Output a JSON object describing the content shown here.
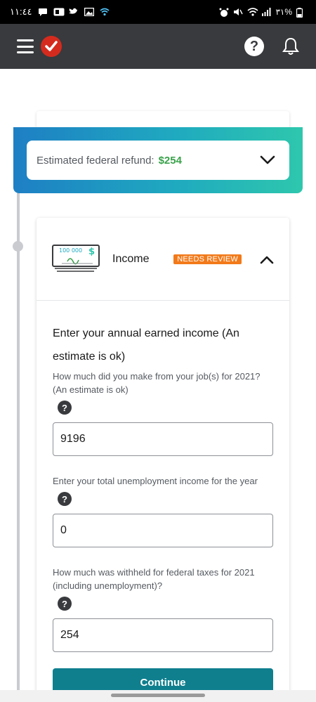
{
  "status_bar": {
    "time": "١١:٤٤",
    "battery": "٣١%"
  },
  "header": {
    "menu_icon": "hamburger-icon",
    "logo_icon": "checkmark-logo-icon",
    "help_label": "?",
    "bell_icon": "bell-icon"
  },
  "refund": {
    "label": "Estimated federal refund:",
    "amount": "$254",
    "amount_color": "#3aa24b"
  },
  "income": {
    "title": "Income",
    "badge": "NEEDS REVIEW",
    "badge_color": "#f27a1a",
    "check_text": "100 000",
    "section_title_line1": "Enter your annual earned income (An",
    "section_title_line2": "estimate is ok)",
    "questions": [
      {
        "label": "How much did you make from your job(s) for 2021? (An estimate is ok)",
        "value": "9196"
      },
      {
        "label": "Enter your total unemployment income for the year",
        "value": "0"
      },
      {
        "label": "How much was withheld for federal taxes for 2021 (including unemployment)?",
        "value": "254"
      }
    ],
    "help_glyph": "?",
    "continue_label": "Continue",
    "continue_color": "#0f7f8e"
  }
}
